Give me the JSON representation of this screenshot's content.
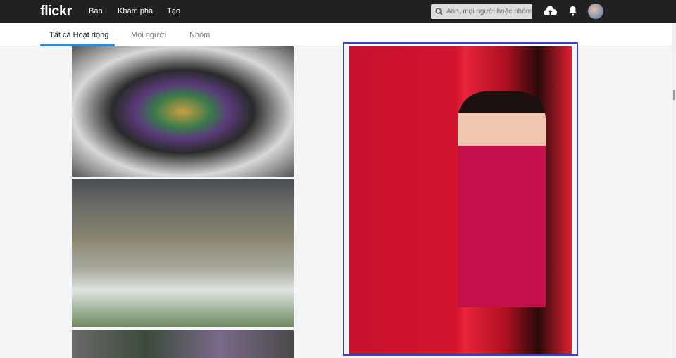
{
  "header": {
    "logo": "flickr",
    "nav": [
      "Bạn",
      "Khám phá",
      "Tạo"
    ],
    "search_placeholder": "Ảnh, mọi người hoặc nhóm"
  },
  "tabs": [
    {
      "label": "Tất cả Hoạt động",
      "active": true
    },
    {
      "label": "Mọi người"
    },
    {
      "label": "Nhóm"
    }
  ],
  "colors": {
    "accent": "#1d8ee8",
    "selection": "#3b3fc4"
  }
}
